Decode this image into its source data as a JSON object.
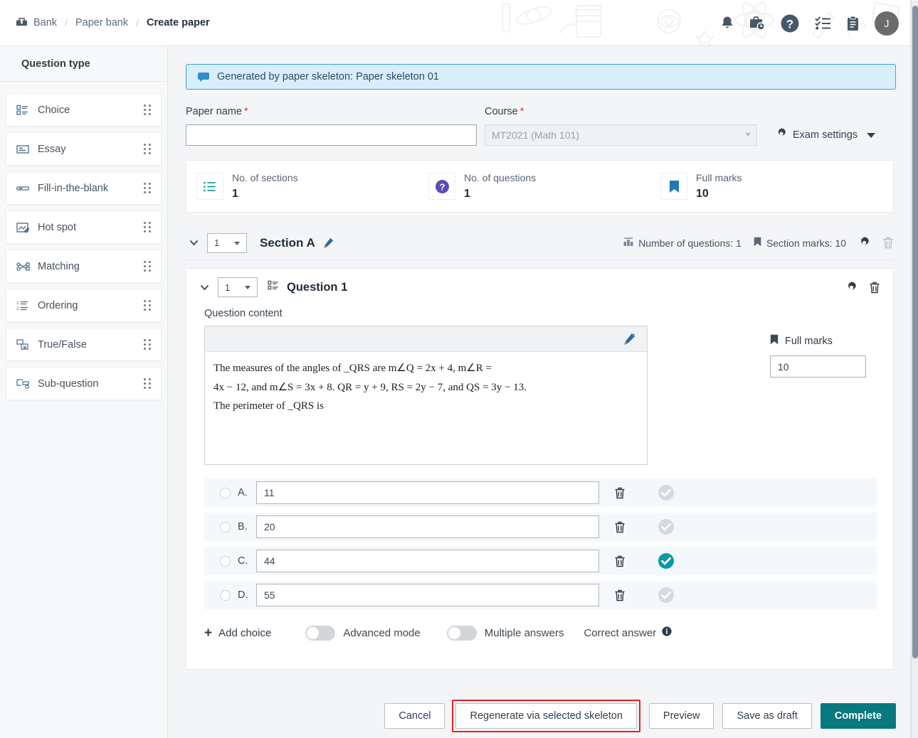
{
  "header": {
    "breadcrumbs": [
      {
        "label": "Bank",
        "icon": "bank-icon",
        "current": false
      },
      {
        "label": "Paper bank",
        "icon": "",
        "current": false
      },
      {
        "label": "Create paper",
        "icon": "",
        "current": true
      }
    ],
    "separator": "/",
    "icons": [
      "bell-icon",
      "briefcase-clock-icon",
      "help-circle-icon",
      "checklist-icon",
      "clipboard-icon"
    ],
    "avatar_initial": "J"
  },
  "sidebar": {
    "title": "Question type",
    "items": [
      {
        "label": "Choice",
        "icon": "choice-list-icon"
      },
      {
        "label": "Essay",
        "icon": "essay-box-icon"
      },
      {
        "label": "Fill-in-the-blank",
        "icon": "blank-line-icon"
      },
      {
        "label": "Hot spot",
        "icon": "hotspot-image-icon"
      },
      {
        "label": "Matching",
        "icon": "matching-link-icon"
      },
      {
        "label": "Ordering",
        "icon": "ordered-list-icon"
      },
      {
        "label": "True/False",
        "icon": "true-false-icon"
      },
      {
        "label": "Sub-question",
        "icon": "sub-question-icon"
      }
    ]
  },
  "banner": {
    "icon": "speech-bubble-icon",
    "text": "Generated by paper skeleton: Paper skeleton 01"
  },
  "form": {
    "paper_name": {
      "label": "Paper name",
      "required": "*",
      "value": "",
      "placeholder": ""
    },
    "course": {
      "label": "Course",
      "required": "*",
      "value": "MT2021 (Math 101)",
      "disabled": true
    },
    "exam_settings": {
      "label": "Exam settings",
      "icon": "gear-icon",
      "caret": "chevron-down-icon"
    }
  },
  "stats": [
    {
      "icon": "list-icon",
      "label": "No. of sections",
      "value": "1",
      "color": "#1a9b96"
    },
    {
      "icon": "question-circle-icon",
      "label": "No. of questions",
      "value": "1",
      "color": "#5f4bb6"
    },
    {
      "icon": "bookmark-icon",
      "label": "Full marks",
      "value": "10",
      "color": "#1f78bd"
    }
  ],
  "section": {
    "collapse_icon": "chevron-down-icon",
    "number": "1",
    "title": "Section A",
    "edit_icon": "pencil-icon",
    "meta": [
      {
        "icon": "questions-count-icon",
        "text": "Number of questions: 1"
      },
      {
        "icon": "bookmark-icon",
        "text": "Section marks: 10"
      }
    ],
    "settings_icon": "gear-icon",
    "delete_icon": "trash-icon"
  },
  "question": {
    "collapse_icon": "chevron-down-icon",
    "number": "1",
    "type_icon": "choice-list-icon",
    "title": "Question 1",
    "settings_icon": "gear-icon",
    "delete_icon": "trash-icon",
    "content_label": "Question content",
    "editor": {
      "edit_icon": "pencil-icon",
      "lines": [
        "The measures of the angles of _QRS are m∠Q = 2x + 4, m∠R =",
        "4x − 12, and m∠S = 3x + 8. QR = y + 9, RS = 2y − 7, and QS = 3y − 13.",
        "The perimeter of _QRS is"
      ]
    },
    "full_marks": {
      "icon": "bookmark-icon",
      "label": "Full marks",
      "value": "10"
    },
    "choices": [
      {
        "letter": "A.",
        "value": "11",
        "correct": false,
        "delete_icon": "trash-icon",
        "check_icon": "check-circle-icon"
      },
      {
        "letter": "B.",
        "value": "20",
        "correct": false,
        "delete_icon": "trash-icon",
        "check_icon": "check-circle-icon"
      },
      {
        "letter": "C.",
        "value": "44",
        "correct": true,
        "delete_icon": "trash-icon",
        "check_icon": "check-circle-icon"
      },
      {
        "letter": "D.",
        "value": "55",
        "correct": false,
        "delete_icon": "trash-icon",
        "check_icon": "check-circle-icon"
      }
    ],
    "controls": {
      "add_choice": "Add choice",
      "add_icon": "plus-icon",
      "advanced_mode": {
        "label": "Advanced mode",
        "on": false
      },
      "multiple_answers": {
        "label": "Multiple answers",
        "on": false
      },
      "correct_answer": {
        "label": "Correct answer",
        "icon": "info-icon"
      }
    }
  },
  "footer": {
    "cancel": "Cancel",
    "regenerate": "Regenerate via selected skeleton",
    "preview": "Preview",
    "save_draft": "Save as draft",
    "complete": "Complete"
  },
  "colors": {
    "accent_teal": "#07787e",
    "correct_check": "#0a9aa6",
    "highlight_red": "#f01f1f",
    "banner_bg": "#d9eefb",
    "banner_border": "#3fa3d6",
    "required_red": "#e3342f"
  }
}
